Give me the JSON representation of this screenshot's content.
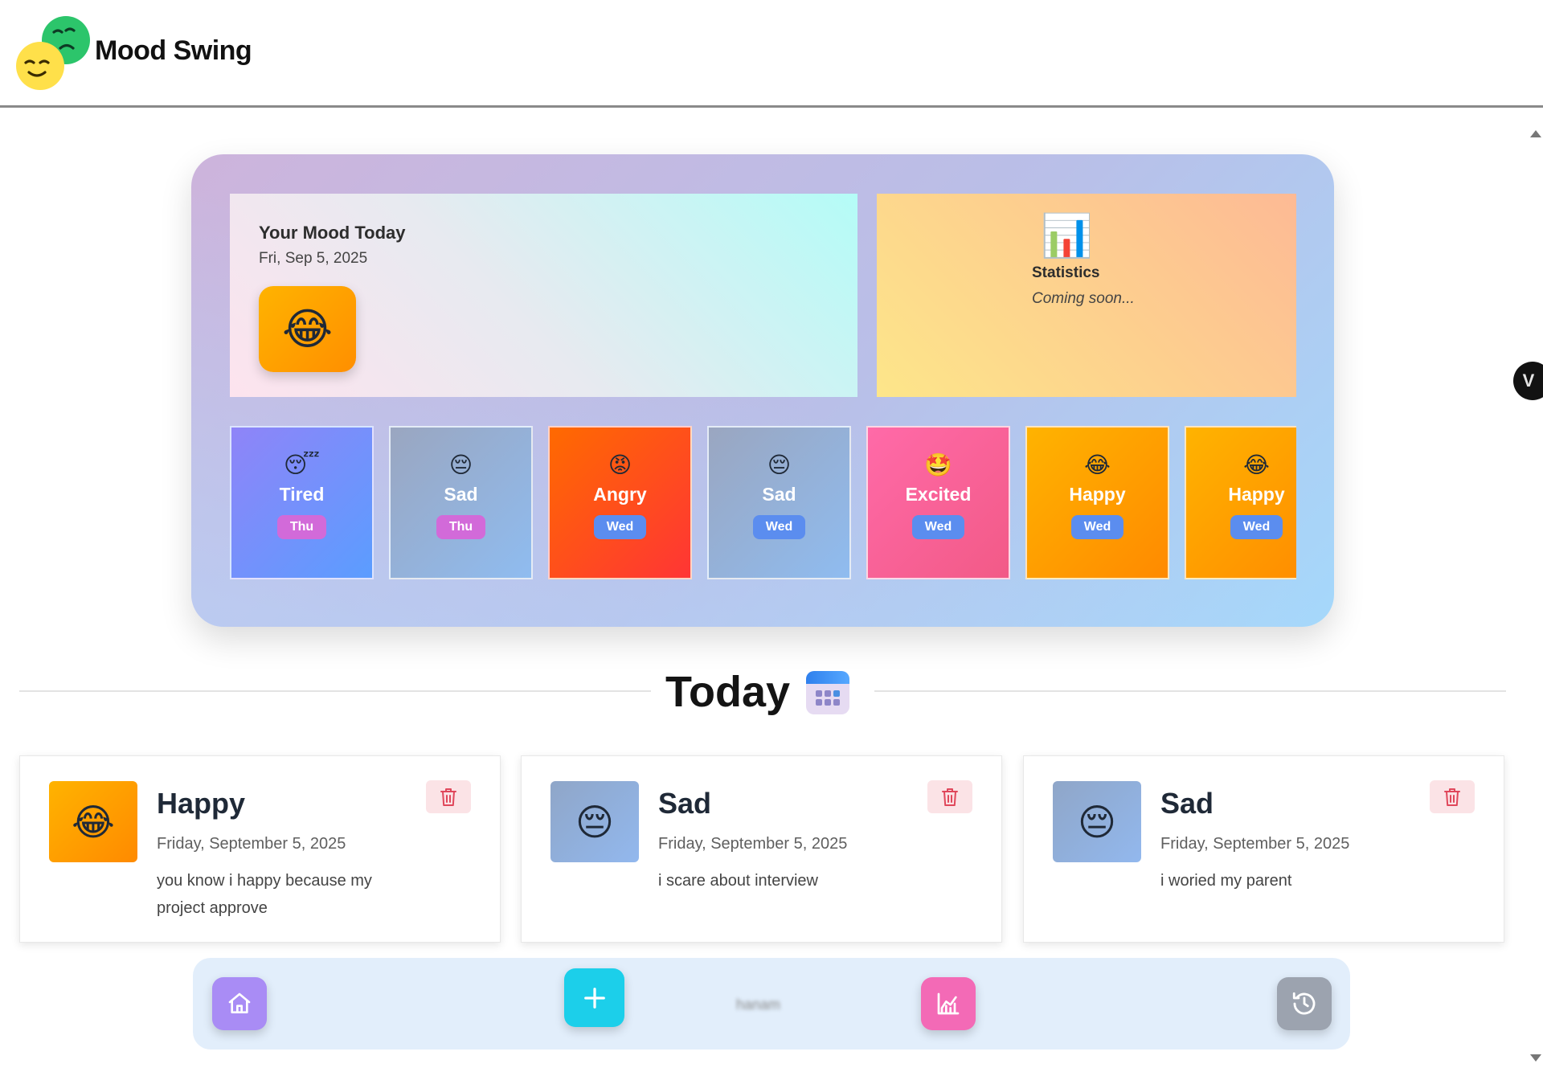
{
  "header": {
    "brand": "Mood Swing",
    "logo_icon": "mood-masks-icon"
  },
  "hero": {
    "today_card": {
      "title": "Your Mood Today",
      "date": "Fri, Sep 5, 2025",
      "emoji": "😂"
    },
    "stats_card": {
      "icon": "📊",
      "title": "Statistics",
      "subtitle": "Coming soon..."
    },
    "mood_history": [
      {
        "emoji": "😴",
        "label": "Tired",
        "day": "Thu",
        "bg": "linear-gradient(135deg,#8f84f8,#5b9dff)"
      },
      {
        "emoji": "😔",
        "label": "Sad",
        "day": "Thu",
        "bg": "linear-gradient(135deg,#9aa6c0,#8fbcf0)"
      },
      {
        "emoji": "😡",
        "label": "Angry",
        "day": "Wed",
        "bg": "linear-gradient(135deg,#ff6a00,#ff3535)"
      },
      {
        "emoji": "😔",
        "label": "Sad",
        "day": "Wed",
        "bg": "linear-gradient(135deg,#9aa6c0,#8fbcf0)"
      },
      {
        "emoji": "🤩",
        "label": "Excited",
        "day": "Wed",
        "bg": "linear-gradient(135deg,#ff6aa8,#f25a87)"
      },
      {
        "emoji": "😂",
        "label": "Happy",
        "day": "Wed",
        "bg": "linear-gradient(135deg,#ffb300,#ff8a00)"
      },
      {
        "emoji": "😂",
        "label": "Happy",
        "day": "Wed",
        "bg": "linear-gradient(135deg,#ffb300,#ff8a00)"
      }
    ]
  },
  "section": {
    "title": "Today",
    "icon": "calendar-icon"
  },
  "entries": [
    {
      "emoji": "😂",
      "title": "Happy",
      "date": "Friday, September 5, 2025",
      "note": "you know i happy because my project approve",
      "delete_icon": "trash-icon"
    },
    {
      "emoji": "😔",
      "title": "Sad",
      "date": "Friday, September 5, 2025",
      "note": "i scare about interview",
      "delete_icon": "trash-icon"
    },
    {
      "emoji": "😔",
      "title": "Sad",
      "date": "Friday, September 5, 2025",
      "note": "i woried my parent",
      "delete_icon": "trash-icon"
    }
  ],
  "bottom_nav": {
    "items": [
      "home-icon",
      "plus-icon",
      "chart-icon",
      "history-icon"
    ],
    "user": "hanam"
  },
  "side_tab": {
    "label": "V"
  },
  "colors": {
    "happy": "#ffa000",
    "sad": "#92aed6",
    "delete_bg": "#fbe3e6",
    "delete_icon": "#e0475b",
    "nav_bg": "#e2eefb"
  }
}
